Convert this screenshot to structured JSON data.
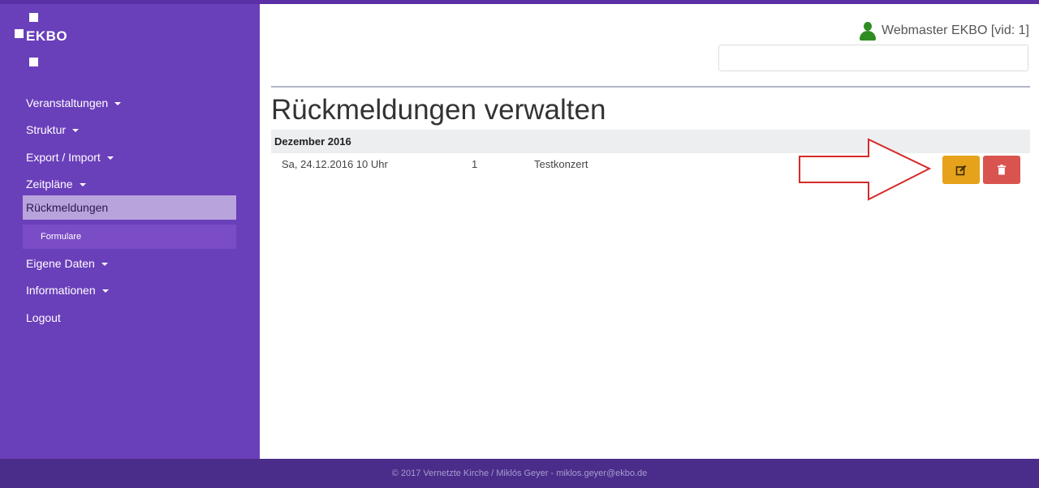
{
  "app": {
    "logo_text": "EKBO"
  },
  "sidebar": {
    "items": [
      {
        "label": "Veranstaltungen",
        "caret": true
      },
      {
        "label": "Struktur",
        "caret": true
      },
      {
        "label": "Export / Import",
        "caret": true
      },
      {
        "label": "Zeitpläne",
        "caret": true
      },
      {
        "label": "Rückmeldungen",
        "caret": false,
        "active": true
      },
      {
        "label": "Formulare",
        "caret": false,
        "sub": true
      },
      {
        "label": "Eigene Daten",
        "caret": true
      },
      {
        "label": "Informationen",
        "caret": true
      },
      {
        "label": "Logout",
        "caret": false
      }
    ]
  },
  "header": {
    "user_label": "Webmaster EKBO [vid: 1]",
    "search_value": ""
  },
  "main": {
    "title": "Rückmeldungen verwalten",
    "groups": [
      {
        "name": "Dezember 2016",
        "rows": [
          {
            "date": "Sa, 24.12.2016 10 Uhr",
            "count": "1",
            "event": "Testkonzert"
          }
        ]
      }
    ]
  },
  "icons": {
    "edit": "edit-icon",
    "delete": "trash-icon",
    "user": "user-icon"
  },
  "colors": {
    "sidebar": "#6a3fba",
    "active_item": "#b8a3dd",
    "edit_button": "#e6a21a",
    "delete_button": "#d9534f",
    "footer": "#4a2d8a"
  },
  "footer": {
    "text": "© 2017 Vernetzte Kirche / Miklós Geyer - miklos.geyer@ekbo.de"
  }
}
